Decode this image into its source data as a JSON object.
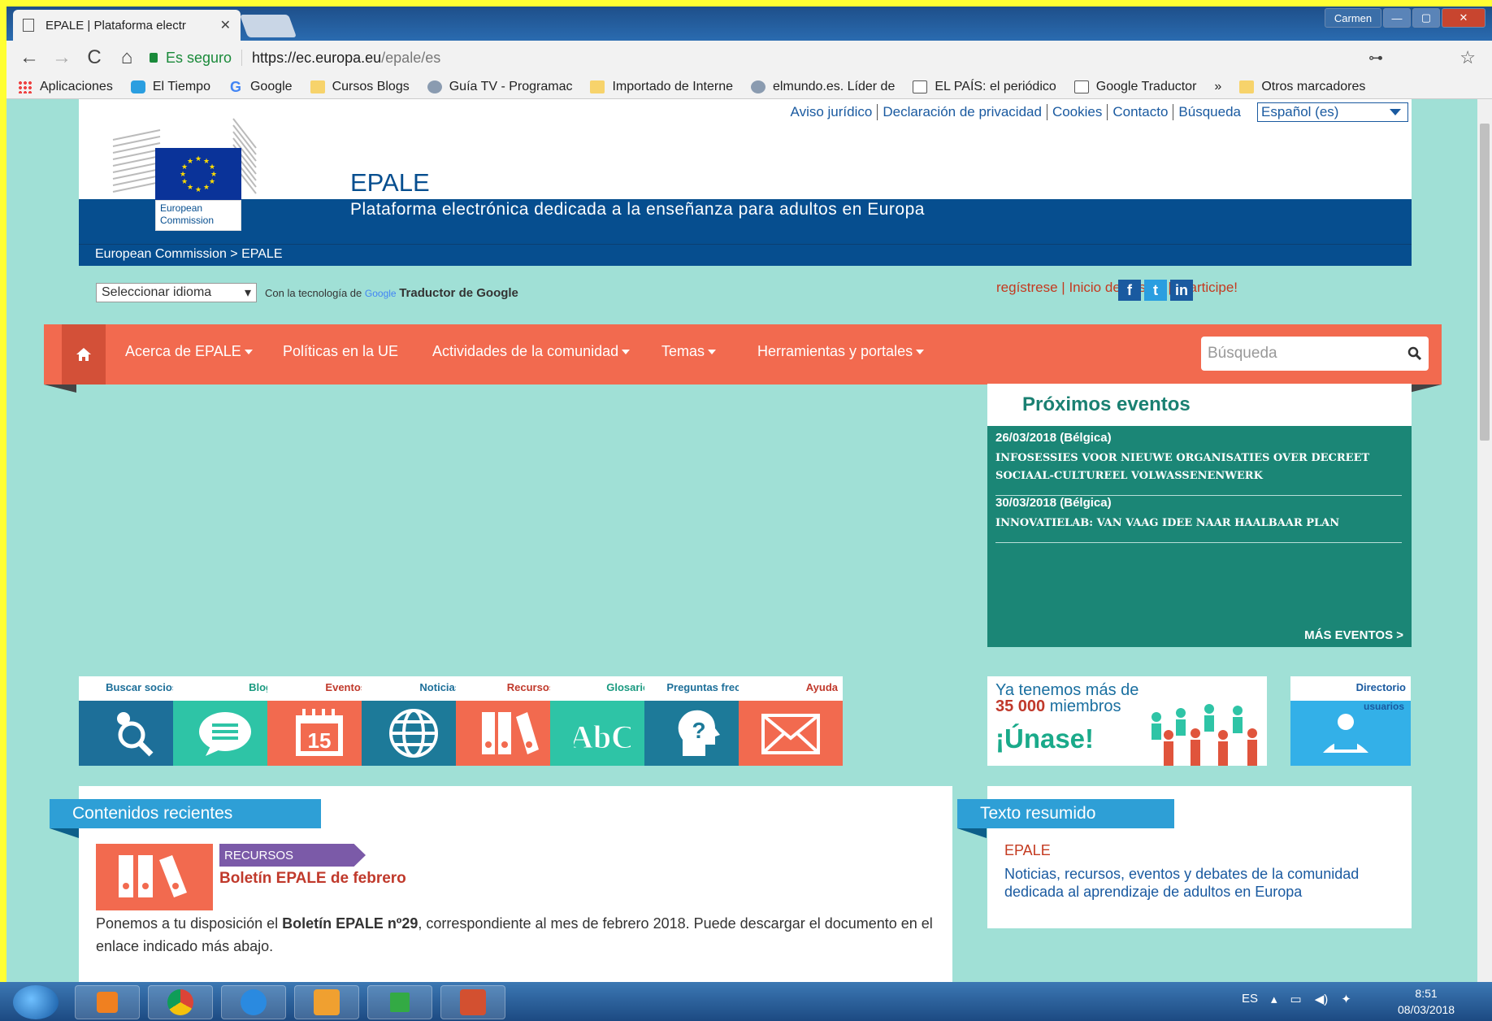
{
  "browser": {
    "tab_title": "EPALE | Plataforma electr",
    "tab_close": "✕",
    "user": "Carmen",
    "min": "—",
    "max": "▢",
    "close": "✕",
    "secure": "Es seguro",
    "url_host": "https://ec.europa.eu",
    "url_path": "/epale/es",
    "back": "←",
    "forward": "→",
    "reload": "C",
    "home": "⌂",
    "key": "⊶",
    "star": "☆"
  },
  "bookmarks": [
    {
      "label": "Aplicaciones",
      "icon": "apps-icon"
    },
    {
      "label": "El Tiempo",
      "icon": "weather-icon"
    },
    {
      "label": "Google",
      "icon": "google-icon"
    },
    {
      "label": "Cursos Blogs",
      "icon": "folder-icon"
    },
    {
      "label": "Guía TV - Programac",
      "icon": "globe-icon"
    },
    {
      "label": "Importado de Interne",
      "icon": "folder-icon"
    },
    {
      "label": "elmundo.es. Líder de",
      "icon": "globe-icon"
    },
    {
      "label": "EL PAÍS: el periódico",
      "icon": "page-icon"
    },
    {
      "label": "Google Traductor",
      "icon": "page-icon"
    },
    {
      "label": "»",
      "icon": ""
    },
    {
      "label": "Otros marcadores",
      "icon": "folder-icon"
    }
  ],
  "header": {
    "links": [
      "Aviso jurídico",
      "Declaración de privacidad",
      "Cookies",
      "Contacto",
      "Búsqueda"
    ],
    "lang": "Español (es)",
    "ec_caption_1": "European",
    "ec_caption_2": "Commission",
    "title": "EPALE",
    "subtitle": "Plataforma electrónica dedicada a la enseñanza para adultos en Europa",
    "breadcrumb": "European Commission > EPALE"
  },
  "translate": {
    "select": "Seleccionar idioma",
    "powered": "Con la tecnología de",
    "google": "Google",
    "translator": "Traductor de Google"
  },
  "account": {
    "text": "regístrese | Inicio de sesión | ¡Participe!"
  },
  "social": {
    "facebook": "f",
    "twitter": "t",
    "linkedin": "in"
  },
  "nav": {
    "home": "⌂",
    "items": [
      "Acerca de EPALE",
      "Políticas en la UE",
      "Actividades de la comunidad",
      "Temas",
      "Herramientas y portales"
    ],
    "search_placeholder": "Búsqueda",
    "search_icon": "⌕"
  },
  "events": {
    "title": "Próximos eventos",
    "items": [
      {
        "date": "26/03/2018 (Bélgica)",
        "title": "INFOSESSIES VOOR NIEUWE ORGANISATIES OVER DECREET SOCIAAL-CULTUREEL VOLWASSENENWERK"
      },
      {
        "date": "30/03/2018 (Bélgica)",
        "title": "INNOVATIELAB: VAN VAAG IDEE NAAR HAALBAAR PLAN"
      }
    ],
    "more": "MÁS EVENTOS >"
  },
  "tiles": [
    {
      "label": "Buscar socios",
      "color": "#1d6f99",
      "labcolor": "#1d6f99",
      "icon": "search-people-icon",
      "glyph": "🔍"
    },
    {
      "label": "Blog",
      "color": "#2ec4a6",
      "labcolor": "#1a9a80",
      "icon": "blog-icon",
      "glyph": "≡"
    },
    {
      "label": "Eventos",
      "color": "#f26a4f",
      "labcolor": "#c0392b",
      "icon": "calendar-icon",
      "glyph": "15"
    },
    {
      "label": "Noticias",
      "color": "#1d7a99",
      "labcolor": "#1d6f99",
      "icon": "globe-icon",
      "glyph": "🌐"
    },
    {
      "label": "Recursos",
      "color": "#f26a4f",
      "labcolor": "#c0392b",
      "icon": "binders-icon",
      "glyph": "▮▮▮"
    },
    {
      "label": "Glosario",
      "color": "#2ec4a6",
      "labcolor": "#1a9a80",
      "icon": "glossary-icon",
      "glyph": "AbC"
    },
    {
      "label": "Preguntas frec.",
      "color": "#1d7a99",
      "labcolor": "#1d6f99",
      "icon": "faq-icon",
      "glyph": "?"
    },
    {
      "label": "Ayuda",
      "color": "#f26a4f",
      "labcolor": "#c0392b",
      "icon": "envelope-icon",
      "glyph": "✉"
    }
  ],
  "join": {
    "line1": "Ya tenemos más de",
    "count": "35 000",
    "members": "miembros",
    "cta": "¡Únase!"
  },
  "directory": {
    "label": "Directorio",
    "sub": "usuarios"
  },
  "recent": {
    "heading": "Contenidos recientes",
    "tag": "RECURSOS",
    "title": "Boletín EPALE de febrero",
    "body_pre": "Ponemos a tu disposición el ",
    "body_bold": "Boletín EPALE nº29",
    "body_post": ", correspondiente al mes de febrero 2018. Puede descargar el documento en el enlace indicado más abajo."
  },
  "summary": {
    "heading": "Texto resumido",
    "title": "EPALE",
    "body": "Noticias, recursos, eventos y debates de la comunidad dedicada al aprendizaje de adultos en Europa"
  },
  "taskbar": {
    "lang": "ES",
    "time": "8:51",
    "date": "08/03/2018"
  }
}
